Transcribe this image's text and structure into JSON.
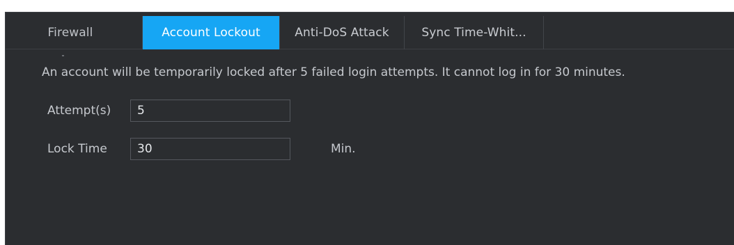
{
  "tabs": [
    {
      "label": "Firewall"
    },
    {
      "label": "Account Lockout"
    },
    {
      "label": "Anti-DoS Attack"
    },
    {
      "label": "Sync Time-Whit..."
    }
  ],
  "active_tab": "Account Lockout",
  "notice": "An account will be temporarily locked after 5 failed login attempts. It cannot log in for 30 minutes.",
  "form": {
    "attempts_label": "Attempt(s)",
    "attempts_value": "5",
    "lock_time_label": "Lock Time",
    "lock_time_value": "30",
    "lock_time_unit": "Min."
  },
  "colors": {
    "background": "#2b2d30",
    "active_tab": "#16a6f4",
    "text": "#c6c9ce"
  }
}
